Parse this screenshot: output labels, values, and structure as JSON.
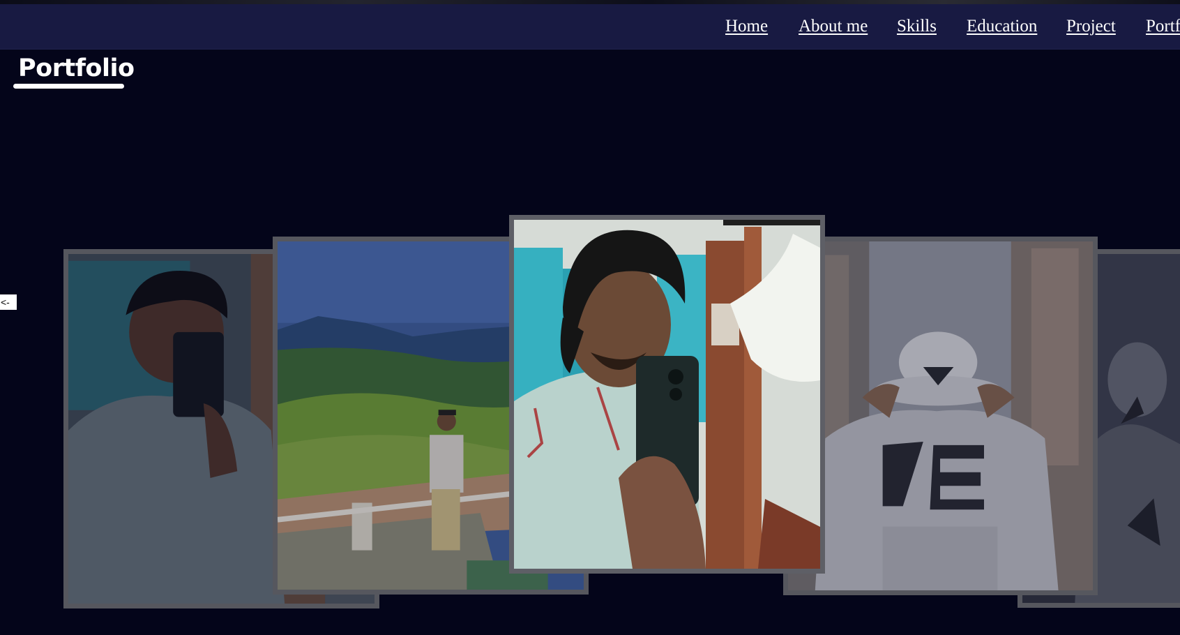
{
  "nav": {
    "items": [
      {
        "label": "Home"
      },
      {
        "label": "About me"
      },
      {
        "label": "Skills"
      },
      {
        "label": "Education"
      },
      {
        "label": "Project"
      },
      {
        "label": "Portf"
      }
    ]
  },
  "brand": {
    "title": "Portfolio"
  },
  "carousel": {
    "prev_label": "<-",
    "slides": [
      {
        "name": "selfie-with-phone",
        "active": false
      },
      {
        "name": "mountain-view",
        "active": false
      },
      {
        "name": "selfie-with-phone",
        "active": true
      },
      {
        "name": "grey-hoodie-cap",
        "active": false
      },
      {
        "name": "hoodie-pose",
        "active": false
      }
    ]
  },
  "colors": {
    "background": "#04051a",
    "navbar": "#181a42",
    "text": "#ffffff",
    "card_border": "#56575e"
  }
}
